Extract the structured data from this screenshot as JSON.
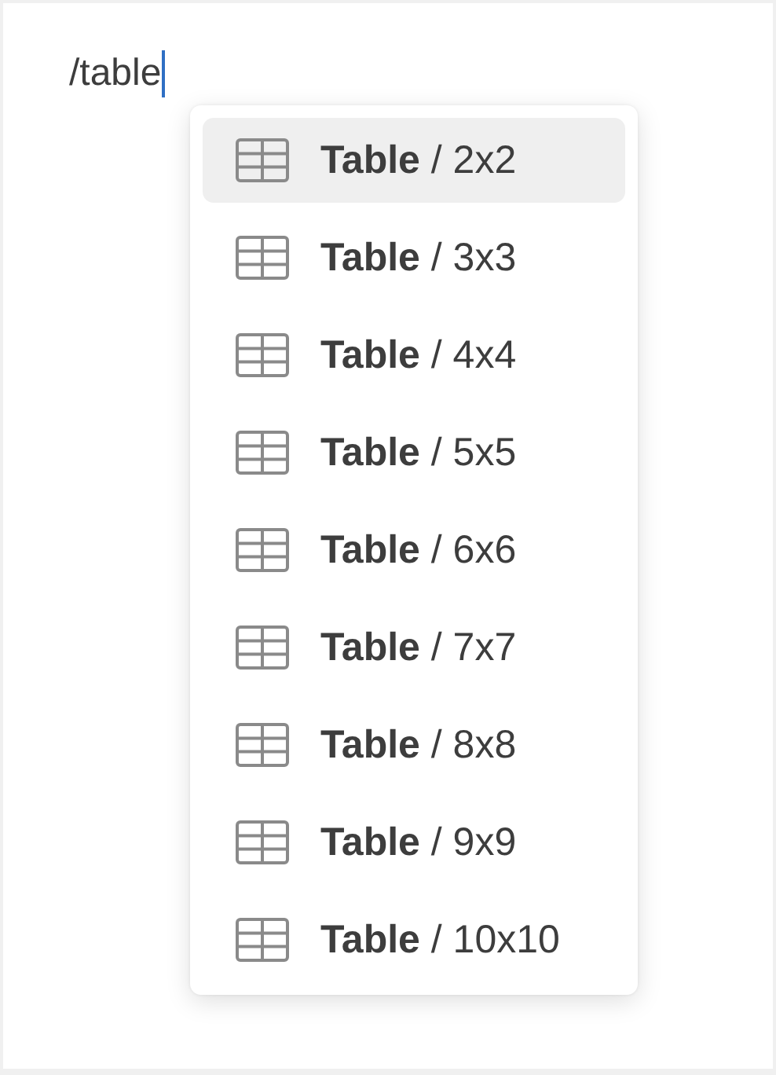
{
  "editor": {
    "value": "/table"
  },
  "menu": {
    "items": [
      {
        "label": "**Table** / 2x2",
        "selected": true
      },
      {
        "label": "**Table** / 3x3",
        "selected": false
      },
      {
        "label": "**Table** / 4x4",
        "selected": false
      },
      {
        "label": "**Table** / 5x5",
        "selected": false
      },
      {
        "label": "**Table** / 6x6",
        "selected": false
      },
      {
        "label": "**Table** / 7x7",
        "selected": false
      },
      {
        "label": "**Table** / 8x8",
        "selected": false
      },
      {
        "label": "**Table** / 9x9",
        "selected": false
      },
      {
        "label": "**Table** / 10x10",
        "selected": false
      }
    ]
  }
}
